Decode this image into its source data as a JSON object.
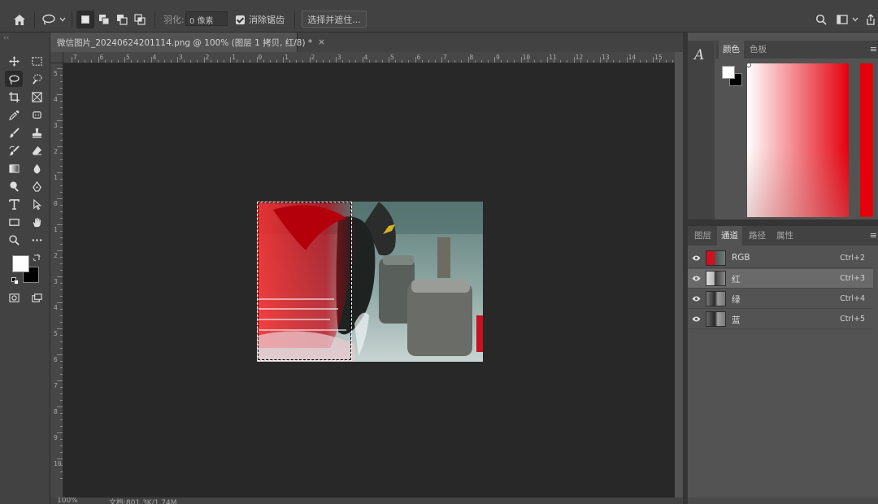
{
  "colors": {
    "panel_bg": "#535353",
    "bar_bg": "#424242",
    "canvas_bg": "#282828",
    "accent_red": "#e4000d"
  },
  "options_bar": {
    "feather_label": "羽化:",
    "feather_value": "0 像素",
    "antialias_label": "消除锯齿",
    "select_and_mask_label": "选择并遮住..."
  },
  "document": {
    "tab_title": "微信图片_20240624201114.png @ 100% (图层 1 拷贝, 红/8) *",
    "close_glyph": "×"
  },
  "rulers": {
    "top_labels": [
      "7",
      "6",
      "5",
      "4",
      "3",
      "2",
      "1",
      "0",
      "1",
      "2",
      "3",
      "4",
      "5",
      "6",
      "7",
      "8",
      "9",
      "10",
      "11",
      "12",
      "13",
      "14",
      "15"
    ],
    "left_labels": [
      "5",
      "4",
      "3",
      "2",
      "1",
      "0",
      "1",
      "2",
      "3",
      "4",
      "5",
      "6",
      "7",
      "8",
      "9",
      "10"
    ]
  },
  "status_bar": {
    "zoom": "100%",
    "doc_info": "文档:801.3K/1.74M"
  },
  "color_panel": {
    "tabs": [
      {
        "label": "颜色",
        "active": true
      },
      {
        "label": "色板",
        "active": false
      }
    ]
  },
  "channels_panel": {
    "tabs": [
      {
        "label": "图层",
        "active": false
      },
      {
        "label": "通道",
        "active": true
      },
      {
        "label": "路径",
        "active": false
      },
      {
        "label": "属性",
        "active": false
      }
    ],
    "channels": [
      {
        "name": "RGB",
        "shortcut": "Ctrl+2",
        "selected": false
      },
      {
        "name": "红",
        "shortcut": "Ctrl+3",
        "selected": true
      },
      {
        "name": "绿",
        "shortcut": "Ctrl+4",
        "selected": false
      },
      {
        "name": "蓝",
        "shortcut": "Ctrl+5",
        "selected": false
      }
    ]
  },
  "icons": [
    "home-icon",
    "lasso-icon",
    "chevron-down-icon",
    "new-selection-icon",
    "add-selection-icon",
    "subtract-selection-icon",
    "intersect-selection-icon",
    "checkbox-icon",
    "search-icon",
    "workspace-icon",
    "share-icon",
    "move-icon",
    "marquee-icon",
    "polygon-lasso-icon",
    "quick-select-icon",
    "crop-icon",
    "frame-icon",
    "eyedropper-icon",
    "patch-icon",
    "brush-icon",
    "stamp-icon",
    "history-brush-icon",
    "eraser-icon",
    "gradient-icon",
    "blur-icon",
    "dodge-icon",
    "pen-icon",
    "type-icon",
    "path-select-icon",
    "rectangle-icon",
    "hand-icon",
    "zoom-icon",
    "more-icon",
    "swap-colors-icon",
    "default-colors-icon",
    "quick-mask-icon",
    "screen-mode-icon",
    "character-icon",
    "eye-icon",
    "panel-menu-icon"
  ]
}
